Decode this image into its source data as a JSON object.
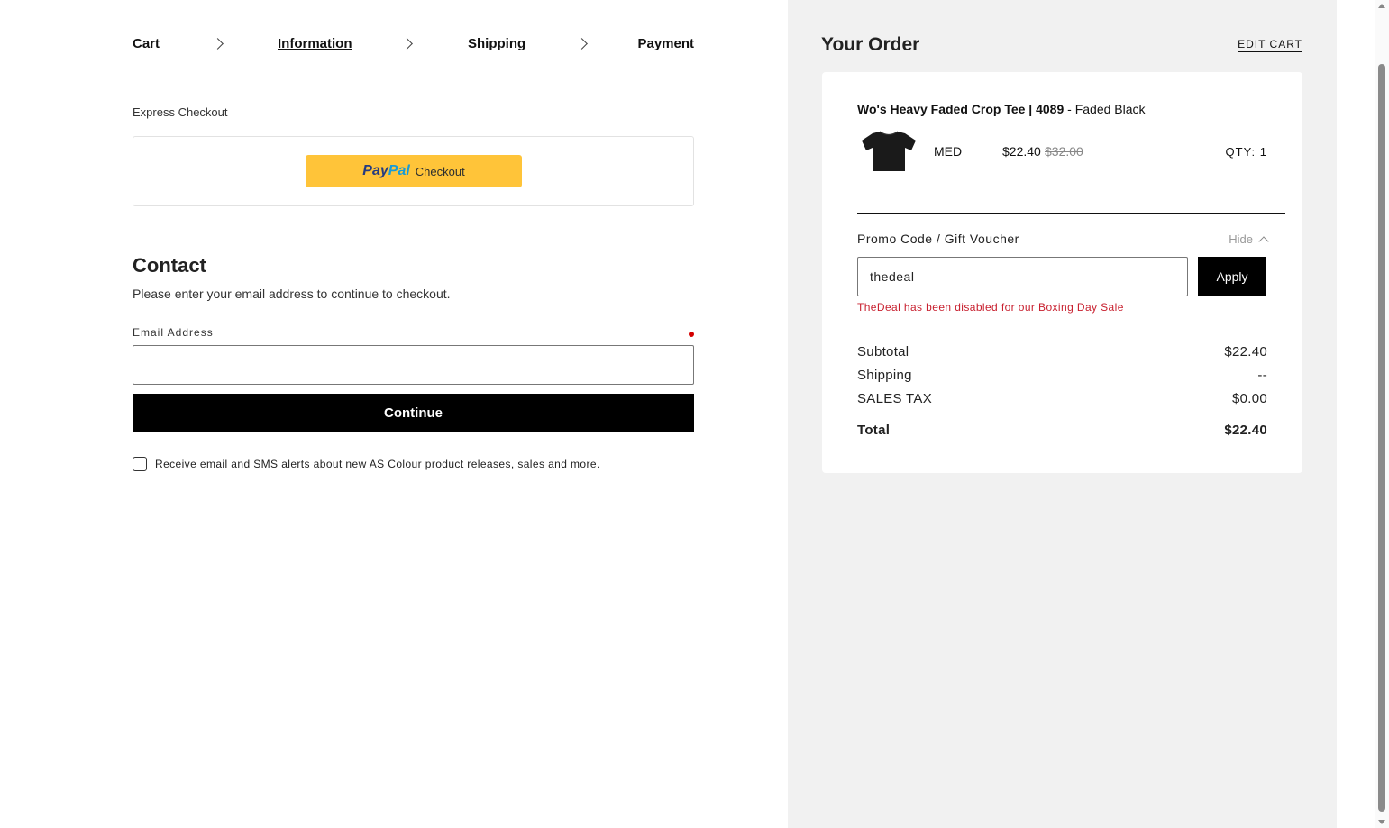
{
  "breadcrumb": {
    "cart": "Cart",
    "information": "Information",
    "shipping": "Shipping",
    "payment": "Payment"
  },
  "express": {
    "label": "Express Checkout",
    "paypal_logo_a": "Pay",
    "paypal_logo_b": "Pal",
    "paypal_text": "Checkout"
  },
  "contact": {
    "title": "Contact",
    "subtitle": "Please enter your email address to continue to checkout.",
    "email_label": "Email Address",
    "email_value": "",
    "continue_label": "Continue",
    "optin_label": "Receive email and SMS alerts about new AS Colour product releases, sales and more.",
    "optin_checked": false
  },
  "order": {
    "title": "Your Order",
    "edit_cart": "EDIT CART",
    "item": {
      "name_bold": "Wo's Heavy Faded Crop Tee | 4089",
      "variant": " - Faded Black",
      "size": "MED",
      "price": "$22.40",
      "original_price": "$32.00",
      "qty": "QTY: 1",
      "thumb_icon": "tshirt-icon"
    },
    "promo": {
      "label": "Promo Code / Gift Voucher",
      "hide": "Hide",
      "value": "thedeal",
      "apply": "Apply",
      "error": "TheDeal has been disabled for our Boxing Day Sale"
    },
    "summary": {
      "subtotal_label": "Subtotal",
      "subtotal": "$22.40",
      "shipping_label": "Shipping",
      "shipping": "--",
      "tax_label": "SALES TAX",
      "tax": "$0.00",
      "total_label": "Total",
      "total": "$22.40"
    }
  },
  "colors": {
    "accent": "#000000",
    "paypal_yellow": "#ffc439",
    "error_red": "#c8202f",
    "sidebar_bg": "#f1f1f1"
  }
}
